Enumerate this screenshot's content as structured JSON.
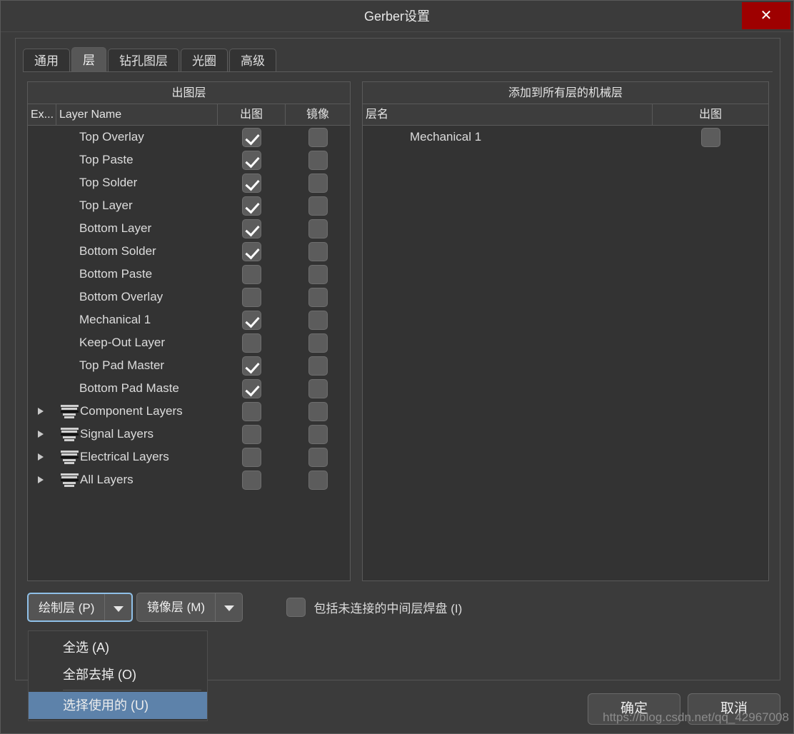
{
  "window": {
    "title": "Gerber设置",
    "close_label": "✕"
  },
  "tabs": [
    {
      "label": "通用",
      "active": false
    },
    {
      "label": "层",
      "active": true
    },
    {
      "label": "钻孔图层",
      "active": false
    },
    {
      "label": "光圈",
      "active": false
    },
    {
      "label": "高级",
      "active": false
    }
  ],
  "left_panel": {
    "caption": "出图层",
    "headers": {
      "ex": "Ex...",
      "name": "Layer Name",
      "plot": "出图",
      "mirror": "镜像"
    },
    "rows": [
      {
        "name": "Top Overlay",
        "icon": "layer-swatch-icon",
        "group": false,
        "plot": true,
        "mirror": false
      },
      {
        "name": "Top Paste",
        "icon": "layer-swatch-icon",
        "group": false,
        "plot": true,
        "mirror": false
      },
      {
        "name": "Top Solder",
        "icon": "layer-swatch-icon",
        "group": false,
        "plot": true,
        "mirror": false
      },
      {
        "name": "Top Layer",
        "icon": "layer-swatch-icon",
        "group": false,
        "plot": true,
        "mirror": false
      },
      {
        "name": "Bottom Layer",
        "icon": "layer-swatch-icon",
        "group": false,
        "plot": true,
        "mirror": false
      },
      {
        "name": "Bottom Solder",
        "icon": "layer-swatch-icon",
        "group": false,
        "plot": true,
        "mirror": false
      },
      {
        "name": "Bottom Paste",
        "icon": "layer-swatch-icon",
        "group": false,
        "plot": false,
        "mirror": false
      },
      {
        "name": "Bottom Overlay",
        "icon": "layer-swatch-icon",
        "group": false,
        "plot": false,
        "mirror": false
      },
      {
        "name": "Mechanical 1",
        "icon": "layer-swatch-icon",
        "group": false,
        "plot": true,
        "mirror": false
      },
      {
        "name": "Keep-Out Layer",
        "icon": "layer-swatch-icon",
        "group": false,
        "plot": false,
        "mirror": false
      },
      {
        "name": "Top Pad Master",
        "icon": "layer-swatch-icon",
        "group": false,
        "plot": true,
        "mirror": false
      },
      {
        "name": "Bottom Pad Maste",
        "icon": "layer-swatch-icon",
        "group": false,
        "plot": true,
        "mirror": false
      },
      {
        "name": "Component Layers",
        "icon": "layer-group-icon",
        "group": true,
        "plot": false,
        "mirror": false
      },
      {
        "name": "Signal Layers",
        "icon": "layer-group-icon",
        "group": true,
        "plot": false,
        "mirror": false
      },
      {
        "name": "Electrical Layers",
        "icon": "layer-group-icon",
        "group": true,
        "plot": false,
        "mirror": false
      },
      {
        "name": "All Layers",
        "icon": "layer-group-icon",
        "group": true,
        "plot": false,
        "mirror": false
      }
    ]
  },
  "right_panel": {
    "caption": "添加到所有层的机械层",
    "headers": {
      "name": "层名",
      "plot": "出图"
    },
    "rows": [
      {
        "name": "Mechanical 1",
        "icon": "layer-swatch-icon",
        "plot": false
      }
    ]
  },
  "bottom_controls": {
    "plot_layers_button": "绘制层 (P)",
    "mirror_layers_button": "镜像层 (M)",
    "include_pads_checkbox": {
      "label": "包括未连接的中间层焊盘 (I)",
      "checked": false
    }
  },
  "dropdown_menu": {
    "items": [
      {
        "label": "全选 (A)",
        "selected": false,
        "separator_after": false
      },
      {
        "label": "全部去掉 (O)",
        "selected": false,
        "separator_after": true
      },
      {
        "label": "选择使用的 (U)",
        "selected": true,
        "separator_after": false
      }
    ]
  },
  "footer": {
    "ok": "确定",
    "cancel": "取消"
  },
  "watermark": "https://blog.csdn.net/qq_42967008",
  "colors": {
    "dialog_bg": "#3b3b3b",
    "panel_bg": "#333333",
    "close_red": "#9e0000",
    "menu_highlight": "#5d82aa",
    "focus_border": "#8fc0e8"
  }
}
